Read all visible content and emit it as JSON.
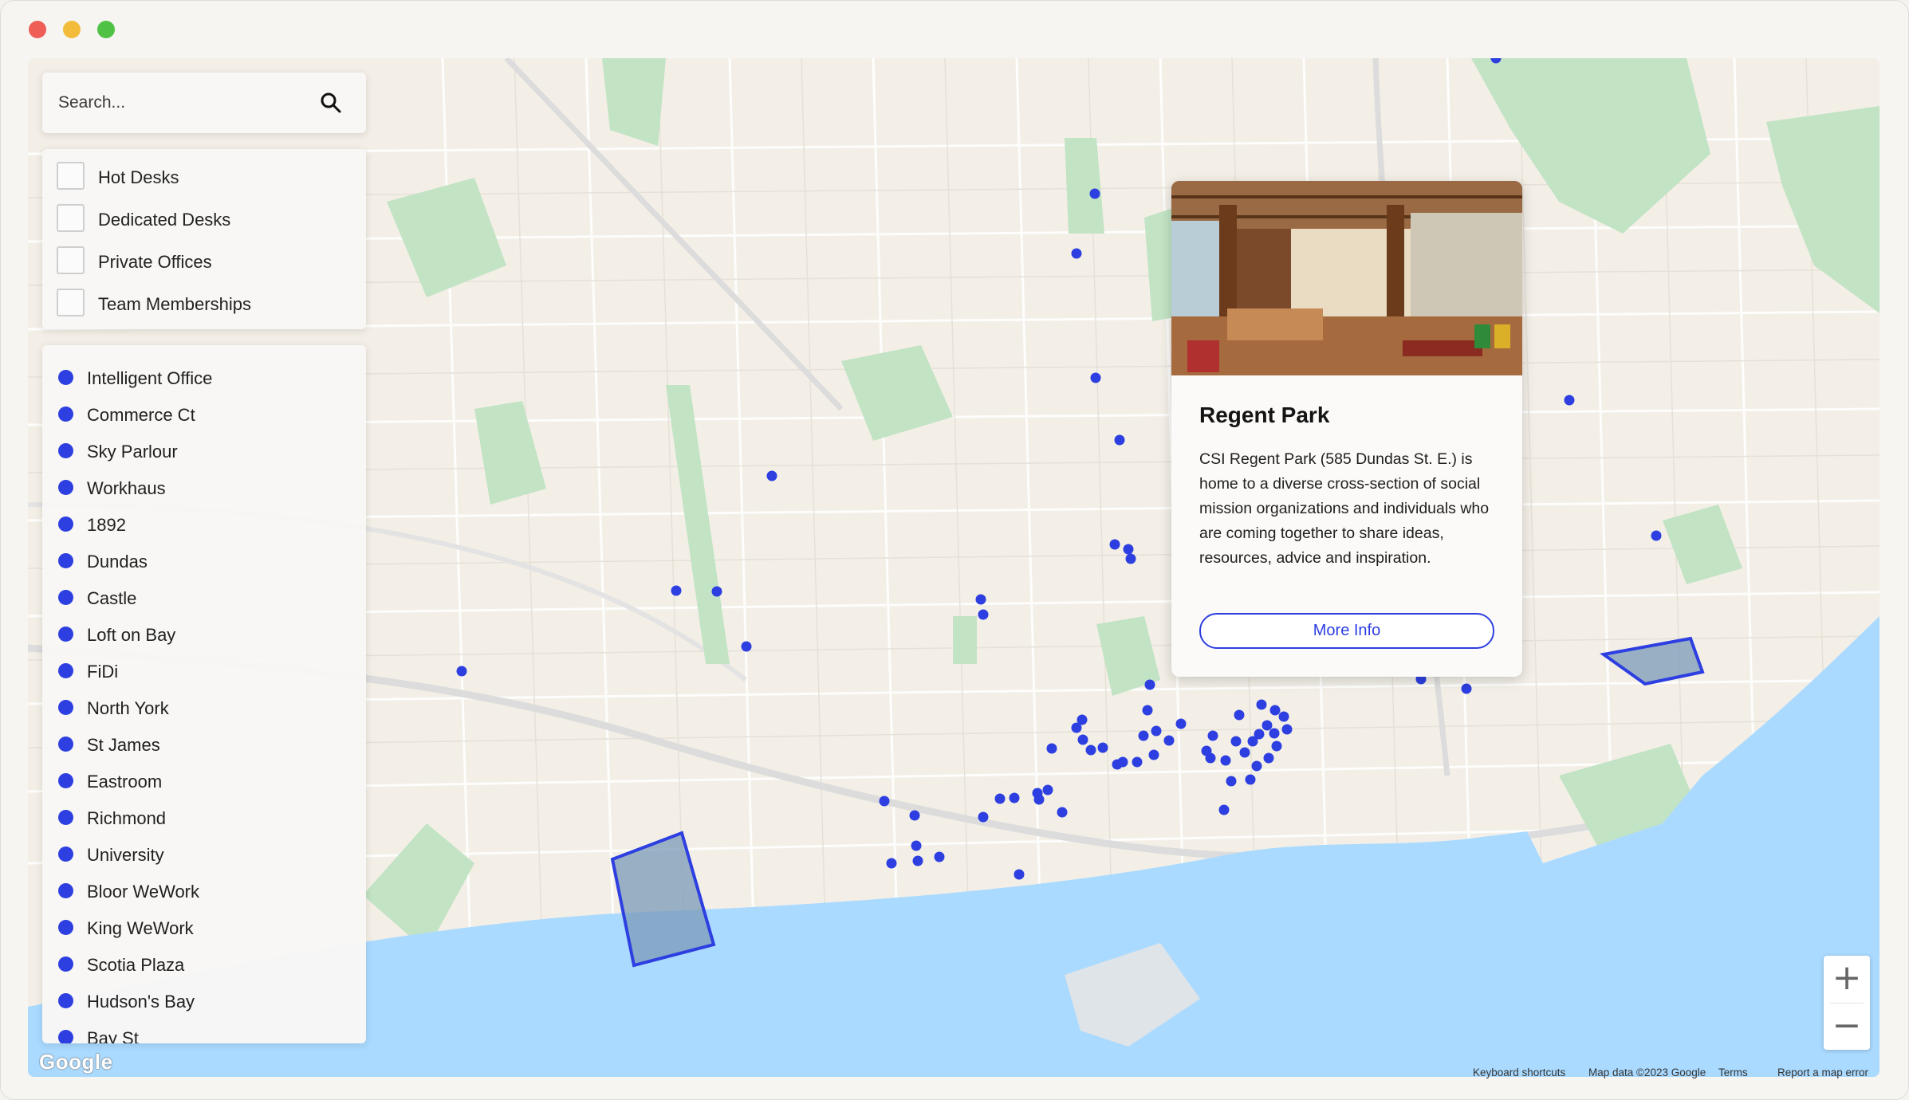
{
  "search": {
    "placeholder": "Search..."
  },
  "filters": [
    {
      "label": "Hot Desks",
      "checked": false
    },
    {
      "label": "Dedicated Desks",
      "checked": false
    },
    {
      "label": "Private Offices",
      "checked": false
    },
    {
      "label": "Team Memberships",
      "checked": false
    }
  ],
  "locations": [
    "Intelligent Office",
    "Commerce Ct",
    "Sky Parlour",
    "Workhaus",
    "1892",
    "Dundas",
    "Castle",
    "Loft on Bay",
    "FiDi",
    "North York",
    "St James",
    "Eastroom",
    "Richmond",
    "University",
    "Bloor WeWork",
    "King WeWork",
    "Scotia Plaza",
    "Hudson's Bay",
    "Bay St"
  ],
  "popup": {
    "title": "Regent Park",
    "description": "CSI Regent Park (585 Dundas St. E.) is home to a diverse cross-section of social mission organizations and individuals who are coming together to share ideas, resources, advice and inspiration.",
    "button_label": "More Info"
  },
  "zoom": {
    "in_label": "+",
    "out_label": "−"
  },
  "map": {
    "logo_text": "Google"
  },
  "attribution": {
    "shortcuts": "Keyboard shortcuts",
    "data": "Map data ©2023 Google",
    "terms": "Terms",
    "report": "Report a map error"
  },
  "colors": {
    "marker": "#2d3fe0",
    "water": "#aadaff",
    "park": "#c2e3c4",
    "land": "#f3efe7"
  }
}
